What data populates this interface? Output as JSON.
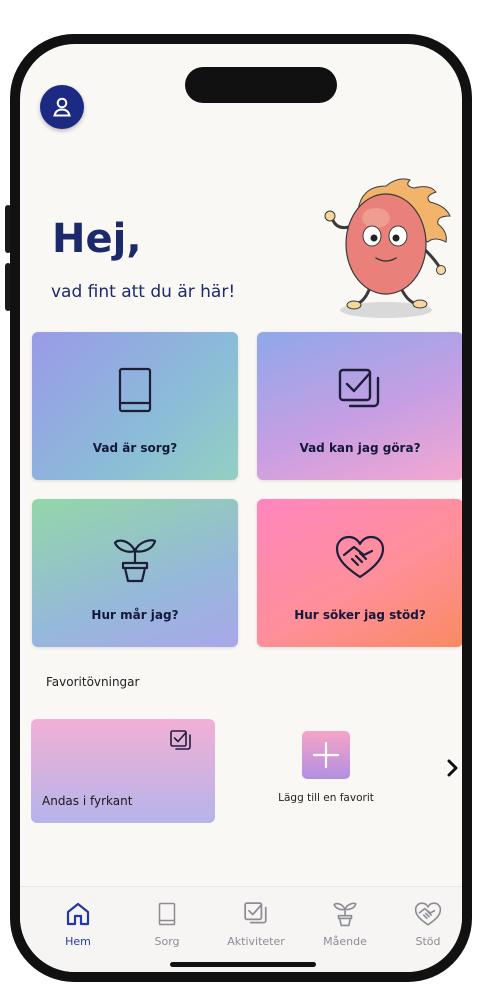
{
  "header": {
    "greeting": "Hej,",
    "subgreeting": "vad fint att du är här!"
  },
  "cards": [
    {
      "label": "Vad är sorg?",
      "icon": "book-icon"
    },
    {
      "label": "Vad kan jag göra?",
      "icon": "checkbox-stack-icon"
    },
    {
      "label": "Hur mår jag?",
      "icon": "plant-icon"
    },
    {
      "label": "Hur söker jag stöd?",
      "icon": "heart-handshake-icon"
    }
  ],
  "favorites": {
    "title": "Favoritövningar",
    "items": [
      {
        "label": "Andas i fyrkant",
        "icon": "checkbox-stack-icon"
      }
    ],
    "add_label": "Lägg till en favorit"
  },
  "tabs": [
    {
      "label": "Hem",
      "icon": "home-icon",
      "active": true
    },
    {
      "label": "Sorg",
      "icon": "book-icon",
      "active": false
    },
    {
      "label": "Aktiviteter",
      "icon": "checkbox-stack-icon",
      "active": false
    },
    {
      "label": "Mående",
      "icon": "plant-icon",
      "active": false
    },
    {
      "label": "Stöd",
      "icon": "heart-handshake-icon",
      "active": false
    }
  ],
  "colors": {
    "primary": "#1c2a84",
    "active_tab": "#2238a8",
    "inactive_tab": "#8c8c94",
    "background": "#faf8f5"
  }
}
